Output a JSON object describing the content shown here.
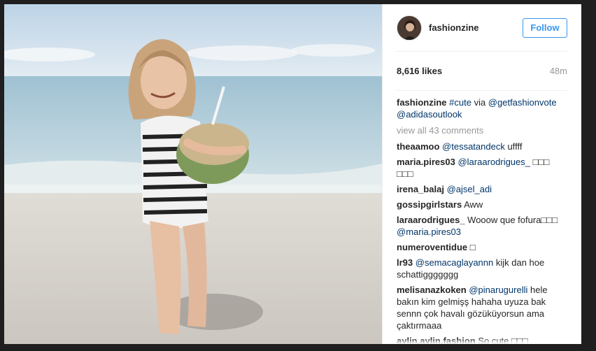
{
  "post": {
    "username": "fashionzine",
    "follow_label": "Follow",
    "likes": "8,616 likes",
    "time": "48m",
    "caption": {
      "user": "fashionzine",
      "tag": "#cute",
      "via": " via ",
      "mention1": "@getfashionvote",
      "mention2": "@adidasoutlook"
    },
    "view_all": "view all 43 comments"
  },
  "comments": [
    {
      "user": "theaamoo",
      "mention": "@tessatandeck",
      "text": " uffff"
    },
    {
      "user": "maria.pires03",
      "mention": "@laraarodrigues_",
      "text": " □□□ □□□"
    },
    {
      "user": "irena_balaj",
      "mention": "@ajsel_adi",
      "text": ""
    },
    {
      "user": "gossipgirlstars",
      "mention": "",
      "text": " Aww"
    },
    {
      "user": "laraarodrigues_",
      "mention": "",
      "text": " Wooow que fofura□□□",
      "mention_after": "@maria.pires03"
    },
    {
      "user": "numeroventidue",
      "mention": "",
      "text": " □"
    },
    {
      "user": "lr93",
      "mention": "@semacaglayannn",
      "text": " kijk dan hoe schattiggggggg"
    },
    {
      "user": "melisanazkoken",
      "mention": "@pinarugurelli",
      "text": " hele bakın kim gelmişş hahaha uyuza bak sennn çok havalı gözüküyorsun ama çaktırmaaa"
    },
    {
      "user": "aylin.aylin.fashion",
      "mention": "",
      "text": " So cute □□□"
    }
  ],
  "colors": {
    "accent": "#3897f0",
    "mention": "#003569",
    "muted": "#999999"
  },
  "icons": {
    "avatar": "profile-photo"
  }
}
